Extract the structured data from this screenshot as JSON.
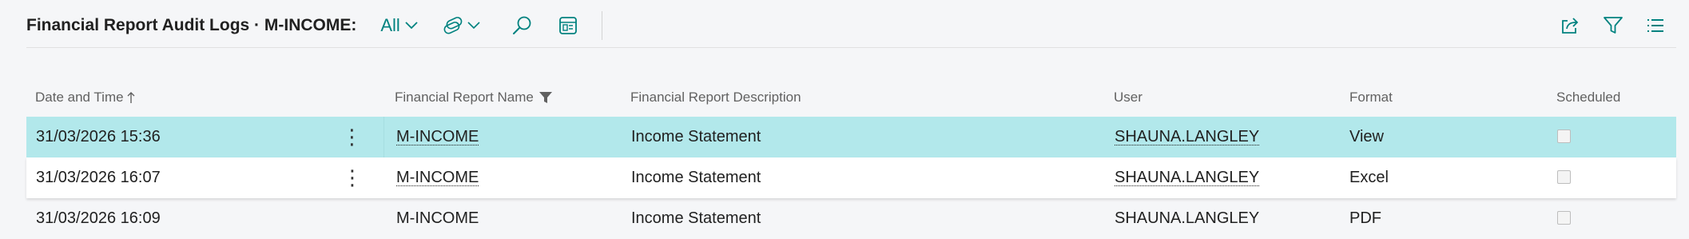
{
  "toolbar": {
    "title": "Financial Report Audit Logs · M-INCOME:",
    "filter_label": "All"
  },
  "icons": {
    "views": "views-icon",
    "search": "search-icon",
    "layout": "layout-icon",
    "share": "share-icon",
    "filter": "filter-icon",
    "list": "list-icon"
  },
  "colors": {
    "accent": "#00827f",
    "selected_row": "#b2e8eb"
  },
  "grid": {
    "columns": {
      "date_time": "Date and Time",
      "report_name": "Financial Report Name",
      "report_description": "Financial Report Description",
      "user": "User",
      "format": "Format",
      "scheduled": "Scheduled"
    },
    "rows": [
      {
        "date_time": "31/03/2026 15:36",
        "report_name": "M-INCOME",
        "report_description": "Income Statement",
        "user": "SHAUNA.LANGLEY",
        "format": "View",
        "scheduled": false
      },
      {
        "date_time": "31/03/2026 16:07",
        "report_name": "M-INCOME",
        "report_description": "Income Statement",
        "user": "SHAUNA.LANGLEY",
        "format": "Excel",
        "scheduled": false
      },
      {
        "date_time": "31/03/2026 16:09",
        "report_name": "M-INCOME",
        "report_description": "Income Statement",
        "user": "SHAUNA.LANGLEY",
        "format": "PDF",
        "scheduled": false
      }
    ]
  }
}
